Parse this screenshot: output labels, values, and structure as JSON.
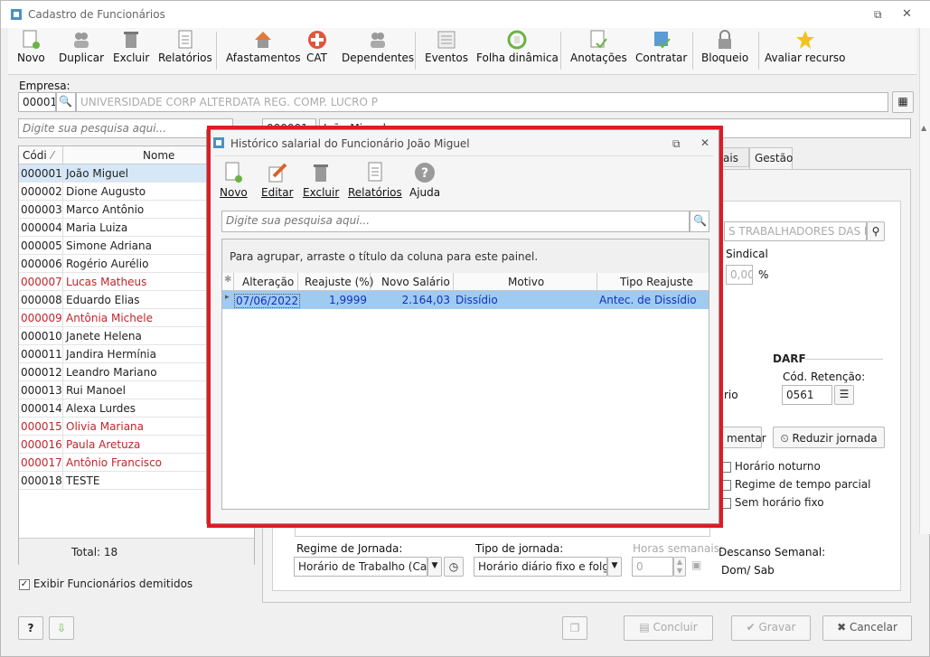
{
  "window": {
    "title": "Cadastro de Funcionários"
  },
  "toolbar": {
    "items": [
      "Novo",
      "Duplicar",
      "Excluir",
      "Relatórios",
      "Afastamentos",
      "CAT",
      "Dependentes",
      "Eventos",
      "Folha dinâmica",
      "Anotações",
      "Contratar",
      "Bloqueio",
      "Avaliar recurso"
    ]
  },
  "empresa": {
    "label": "Empresa:",
    "code": "00001",
    "name": "UNIVERSIDADE CORP ALTERDATA REG. COMP. LUCRO P"
  },
  "search": {
    "placeholder": "Digite sua pesquisa aqui..."
  },
  "behind": {
    "code": "000001",
    "name": "João Miguel",
    "tab_partial": "ais",
    "tab_gestao": "Gestão",
    "sindicato": "S TRABALHADORES DAS EMP",
    "sindical_label": "Sindical",
    "sindical_value": "0,00",
    "percent": "%",
    "darf": "DARF",
    "cod_retencao_label": "Cód. Retenção:",
    "cod_retencao": "0561",
    "rio_partial": "rio",
    "mentar": "mentar",
    "reduzir": "Reduzir jornada",
    "noturno": "Horário noturno",
    "parcial": "Regime de tempo parcial",
    "sem_horario": "Sem horário fixo",
    "regime_label": "Regime de Jornada:",
    "regime_value": "Horário de Trabalho (Cap.",
    "tipo_label": "Tipo de jornada:",
    "tipo_value": "Horário diário fixo e folga f",
    "horas_label": "Horas semanais:",
    "horas_value": "0",
    "descanso_label": "Descanso Semanal:",
    "descanso_value": "Dom/ Sab"
  },
  "grid": {
    "col_code": "Códi",
    "col_name": "Nome",
    "rows": [
      {
        "code": "000001",
        "name": "João Miguel",
        "red": false,
        "sel": true
      },
      {
        "code": "000002",
        "name": "Dione Augusto",
        "red": false
      },
      {
        "code": "000003",
        "name": "Marco Antônio",
        "red": false
      },
      {
        "code": "000004",
        "name": "Maria Luiza",
        "red": false
      },
      {
        "code": "000005",
        "name": "Simone Adriana",
        "red": false
      },
      {
        "code": "000006",
        "name": "Rogério Aurélio",
        "red": false
      },
      {
        "code": "000007",
        "name": "Lucas Matheus",
        "red": true
      },
      {
        "code": "000008",
        "name": "Eduardo Elias",
        "red": false
      },
      {
        "code": "000009",
        "name": "Antônia Michele",
        "red": true
      },
      {
        "code": "000010",
        "name": "Janete Helena",
        "red": false
      },
      {
        "code": "000011",
        "name": "Jandira Hermínia",
        "red": false
      },
      {
        "code": "000012",
        "name": "Leandro Mariano",
        "red": false
      },
      {
        "code": "000013",
        "name": "Rui Manoel",
        "red": false
      },
      {
        "code": "000014",
        "name": "Alexa Lurdes",
        "red": false
      },
      {
        "code": "000015",
        "name": "Olivia Mariana",
        "red": true
      },
      {
        "code": "000016",
        "name": "Paula Aretuza",
        "red": true
      },
      {
        "code": "000017",
        "name": "Antônio Francisco",
        "red": true
      },
      {
        "code": "000018",
        "name": "TESTE",
        "red": false
      }
    ],
    "total": "Total: 18"
  },
  "exibir": "Exibir Funcionários demitidos",
  "footer": {
    "concluir": "Concluir",
    "gravar": "Gravar",
    "cancelar": "Cancelar"
  },
  "dialog": {
    "title": "Histórico salarial do Funcionário João Miguel",
    "toolbar": [
      "Novo",
      "Editar",
      "Excluir",
      "Relatórios",
      "Ajuda"
    ],
    "search_placeholder": "Digite sua pesquisa aqui...",
    "group_hint": "Para agrupar, arraste o título da coluna para este painel.",
    "columns": [
      "Alteração",
      "Reajuste (%)",
      "Novo Salário",
      "Motivo",
      "Tipo Reajuste"
    ],
    "row": {
      "alteracao": "07/06/2022",
      "reajuste": "1,9999",
      "salario": "2.164,03",
      "motivo": "Dissídio",
      "tipo": "Antec. de Dissídio"
    }
  },
  "colors": {
    "red": "#c0262c",
    "highlight": "#e01b24",
    "selection": "#9fcbf0"
  }
}
